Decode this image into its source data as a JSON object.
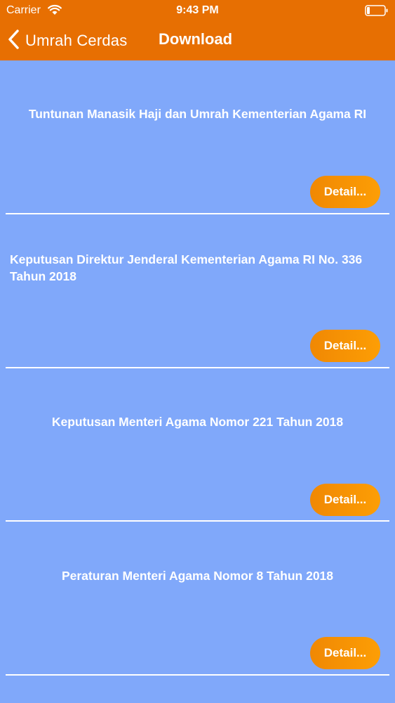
{
  "status_bar": {
    "carrier": "Carrier",
    "time": "9:43 PM"
  },
  "nav": {
    "back_label": "Umrah Cerdas",
    "title": "Download"
  },
  "colors": {
    "nav_background": "#e76f02",
    "list_background": "#80a8fa",
    "button_gradient_start": "#f08803",
    "button_gradient_end": "#fd9e05",
    "text": "#ffffff"
  },
  "items": [
    {
      "title": "Tuntunan Manasik Haji dan Umrah Kementerian Agama RI",
      "button_label": "Detail..."
    },
    {
      "title": " Keputusan Direktur Jenderal Kementerian Agama RI  No. 336 Tahun 2018",
      "button_label": "Detail..."
    },
    {
      "title": "Keputusan Menteri Agama Nomor 221 Tahun 2018",
      "button_label": "Detail..."
    },
    {
      "title": "Peraturan Menteri Agama Nomor 8 Tahun 2018",
      "button_label": "Detail..."
    }
  ]
}
